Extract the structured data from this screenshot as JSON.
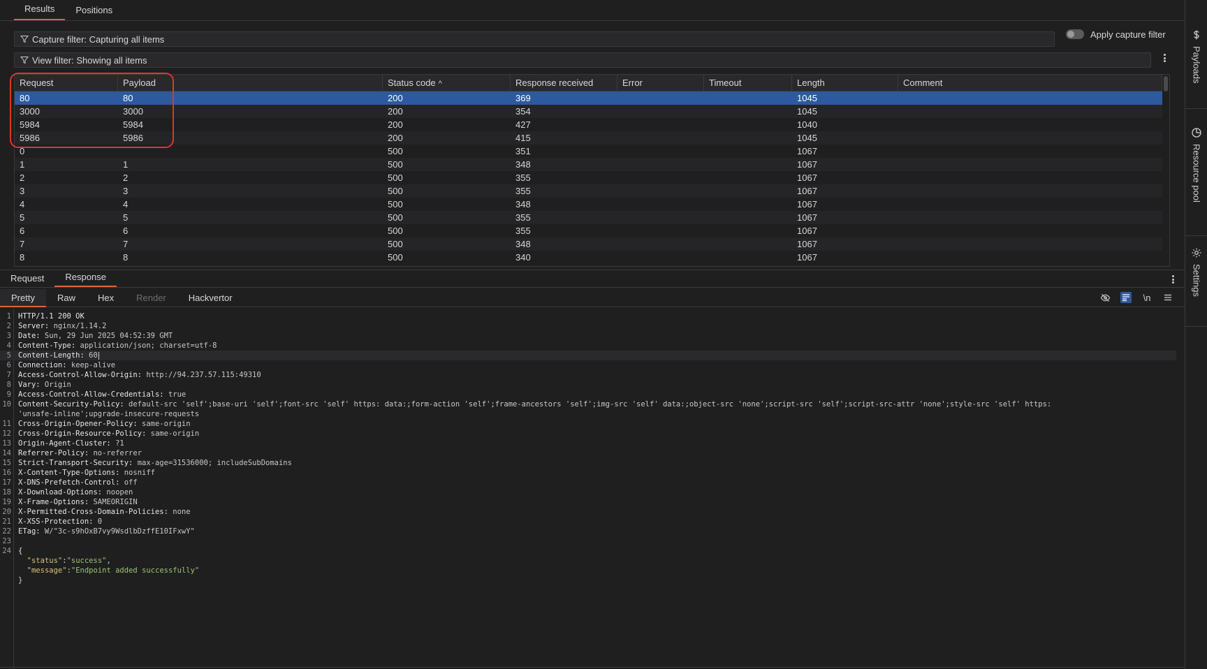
{
  "top_tabs": [
    "Results",
    "Positions"
  ],
  "capture_filter": {
    "label": "Capture filter: Capturing all items",
    "toggle_label": "Apply capture filter"
  },
  "view_filter": {
    "label": "View filter: Showing all items"
  },
  "table": {
    "columns": [
      "Request",
      "Payload",
      "Status code",
      "Response received",
      "Error",
      "Timeout",
      "Length",
      "Comment"
    ],
    "sort_indicator": "^",
    "rows": [
      [
        "80",
        "80",
        "200",
        "369",
        "",
        "",
        "1045",
        ""
      ],
      [
        "3000",
        "3000",
        "200",
        "354",
        "",
        "",
        "1045",
        ""
      ],
      [
        "5984",
        "5984",
        "200",
        "427",
        "",
        "",
        "1040",
        ""
      ],
      [
        "5986",
        "5986",
        "200",
        "415",
        "",
        "",
        "1045",
        ""
      ],
      [
        "0",
        "",
        "500",
        "351",
        "",
        "",
        "1067",
        ""
      ],
      [
        "1",
        "1",
        "500",
        "348",
        "",
        "",
        "1067",
        ""
      ],
      [
        "2",
        "2",
        "500",
        "355",
        "",
        "",
        "1067",
        ""
      ],
      [
        "3",
        "3",
        "500",
        "355",
        "",
        "",
        "1067",
        ""
      ],
      [
        "4",
        "4",
        "500",
        "348",
        "",
        "",
        "1067",
        ""
      ],
      [
        "5",
        "5",
        "500",
        "355",
        "",
        "",
        "1067",
        ""
      ],
      [
        "6",
        "6",
        "500",
        "355",
        "",
        "",
        "1067",
        ""
      ],
      [
        "7",
        "7",
        "500",
        "348",
        "",
        "",
        "1067",
        ""
      ],
      [
        "8",
        "8",
        "500",
        "340",
        "",
        "",
        "1067",
        ""
      ]
    ]
  },
  "panel_tabs": [
    "Request",
    "Response"
  ],
  "view_tabs": [
    "Pretty",
    "Raw",
    "Hex",
    "Render",
    "Hackvertor"
  ],
  "toolbar": {
    "newline_label": "\\n"
  },
  "side_bar": [
    "Payloads",
    "Resource pool",
    "Settings"
  ],
  "response_lines": [
    {
      "n": "1",
      "k": "HTTP/1.1 200 OK",
      "v": ""
    },
    {
      "n": "2",
      "k": "Server:",
      "v": " nginx/1.14.2"
    },
    {
      "n": "3",
      "k": "Date:",
      "v": " Sun, 29 Jun 2025 04:52:39 GMT"
    },
    {
      "n": "4",
      "k": "Content-Type:",
      "v": " application/json; charset=utf-8"
    },
    {
      "n": "5",
      "k": "Content-Length:",
      "v": " 60"
    },
    {
      "n": "6",
      "k": "Connection:",
      "v": " keep-alive"
    },
    {
      "n": "7",
      "k": "Access-Control-Allow-Origin:",
      "v": " http://94.237.57.115:49310"
    },
    {
      "n": "8",
      "k": "Vary:",
      "v": " Origin"
    },
    {
      "n": "9",
      "k": "Access-Control-Allow-Credentials:",
      "v": " true"
    },
    {
      "n": "10",
      "k": "Content-Security-Policy:",
      "v": " default-src 'self';base-uri 'self';font-src 'self' https: data:;form-action 'self';frame-ancestors 'self';img-src 'self' data:;object-src 'none';script-src 'self';script-src-attr 'none';style-src 'self' https:"
    },
    {
      "n": "",
      "k": "",
      "v": "'unsafe-inline';upgrade-insecure-requests"
    },
    {
      "n": "11",
      "k": "Cross-Origin-Opener-Policy:",
      "v": " same-origin"
    },
    {
      "n": "12",
      "k": "Cross-Origin-Resource-Policy:",
      "v": " same-origin"
    },
    {
      "n": "13",
      "k": "Origin-Agent-Cluster:",
      "v": " ?1"
    },
    {
      "n": "14",
      "k": "Referrer-Policy:",
      "v": " no-referrer"
    },
    {
      "n": "15",
      "k": "Strict-Transport-Security:",
      "v": " max-age=31536000; includeSubDomains"
    },
    {
      "n": "16",
      "k": "X-Content-Type-Options:",
      "v": " nosniff"
    },
    {
      "n": "17",
      "k": "X-DNS-Prefetch-Control:",
      "v": " off"
    },
    {
      "n": "18",
      "k": "X-Download-Options:",
      "v": " noopen"
    },
    {
      "n": "19",
      "k": "X-Frame-Options:",
      "v": " SAMEORIGIN"
    },
    {
      "n": "20",
      "k": "X-Permitted-Cross-Domain-Policies:",
      "v": " none"
    },
    {
      "n": "21",
      "k": "X-XSS-Protection:",
      "v": " 0"
    },
    {
      "n": "22",
      "k": "ETag:",
      "v": " W/\"3c-s9hOxB7vy9WsdlbDzffE10IFxwY\""
    },
    {
      "n": "23",
      "k": "",
      "v": ""
    },
    {
      "n": "24",
      "k": "{",
      "v": ""
    }
  ],
  "json_body": {
    "line1_key": "\"status\"",
    "line1_sep": ":",
    "line1_val": "\"success\"",
    "line1_end": ",",
    "line2_key": "\"message\"",
    "line2_sep": ":",
    "line2_val": "\"Endpoint added successfully\"",
    "close": "}"
  }
}
